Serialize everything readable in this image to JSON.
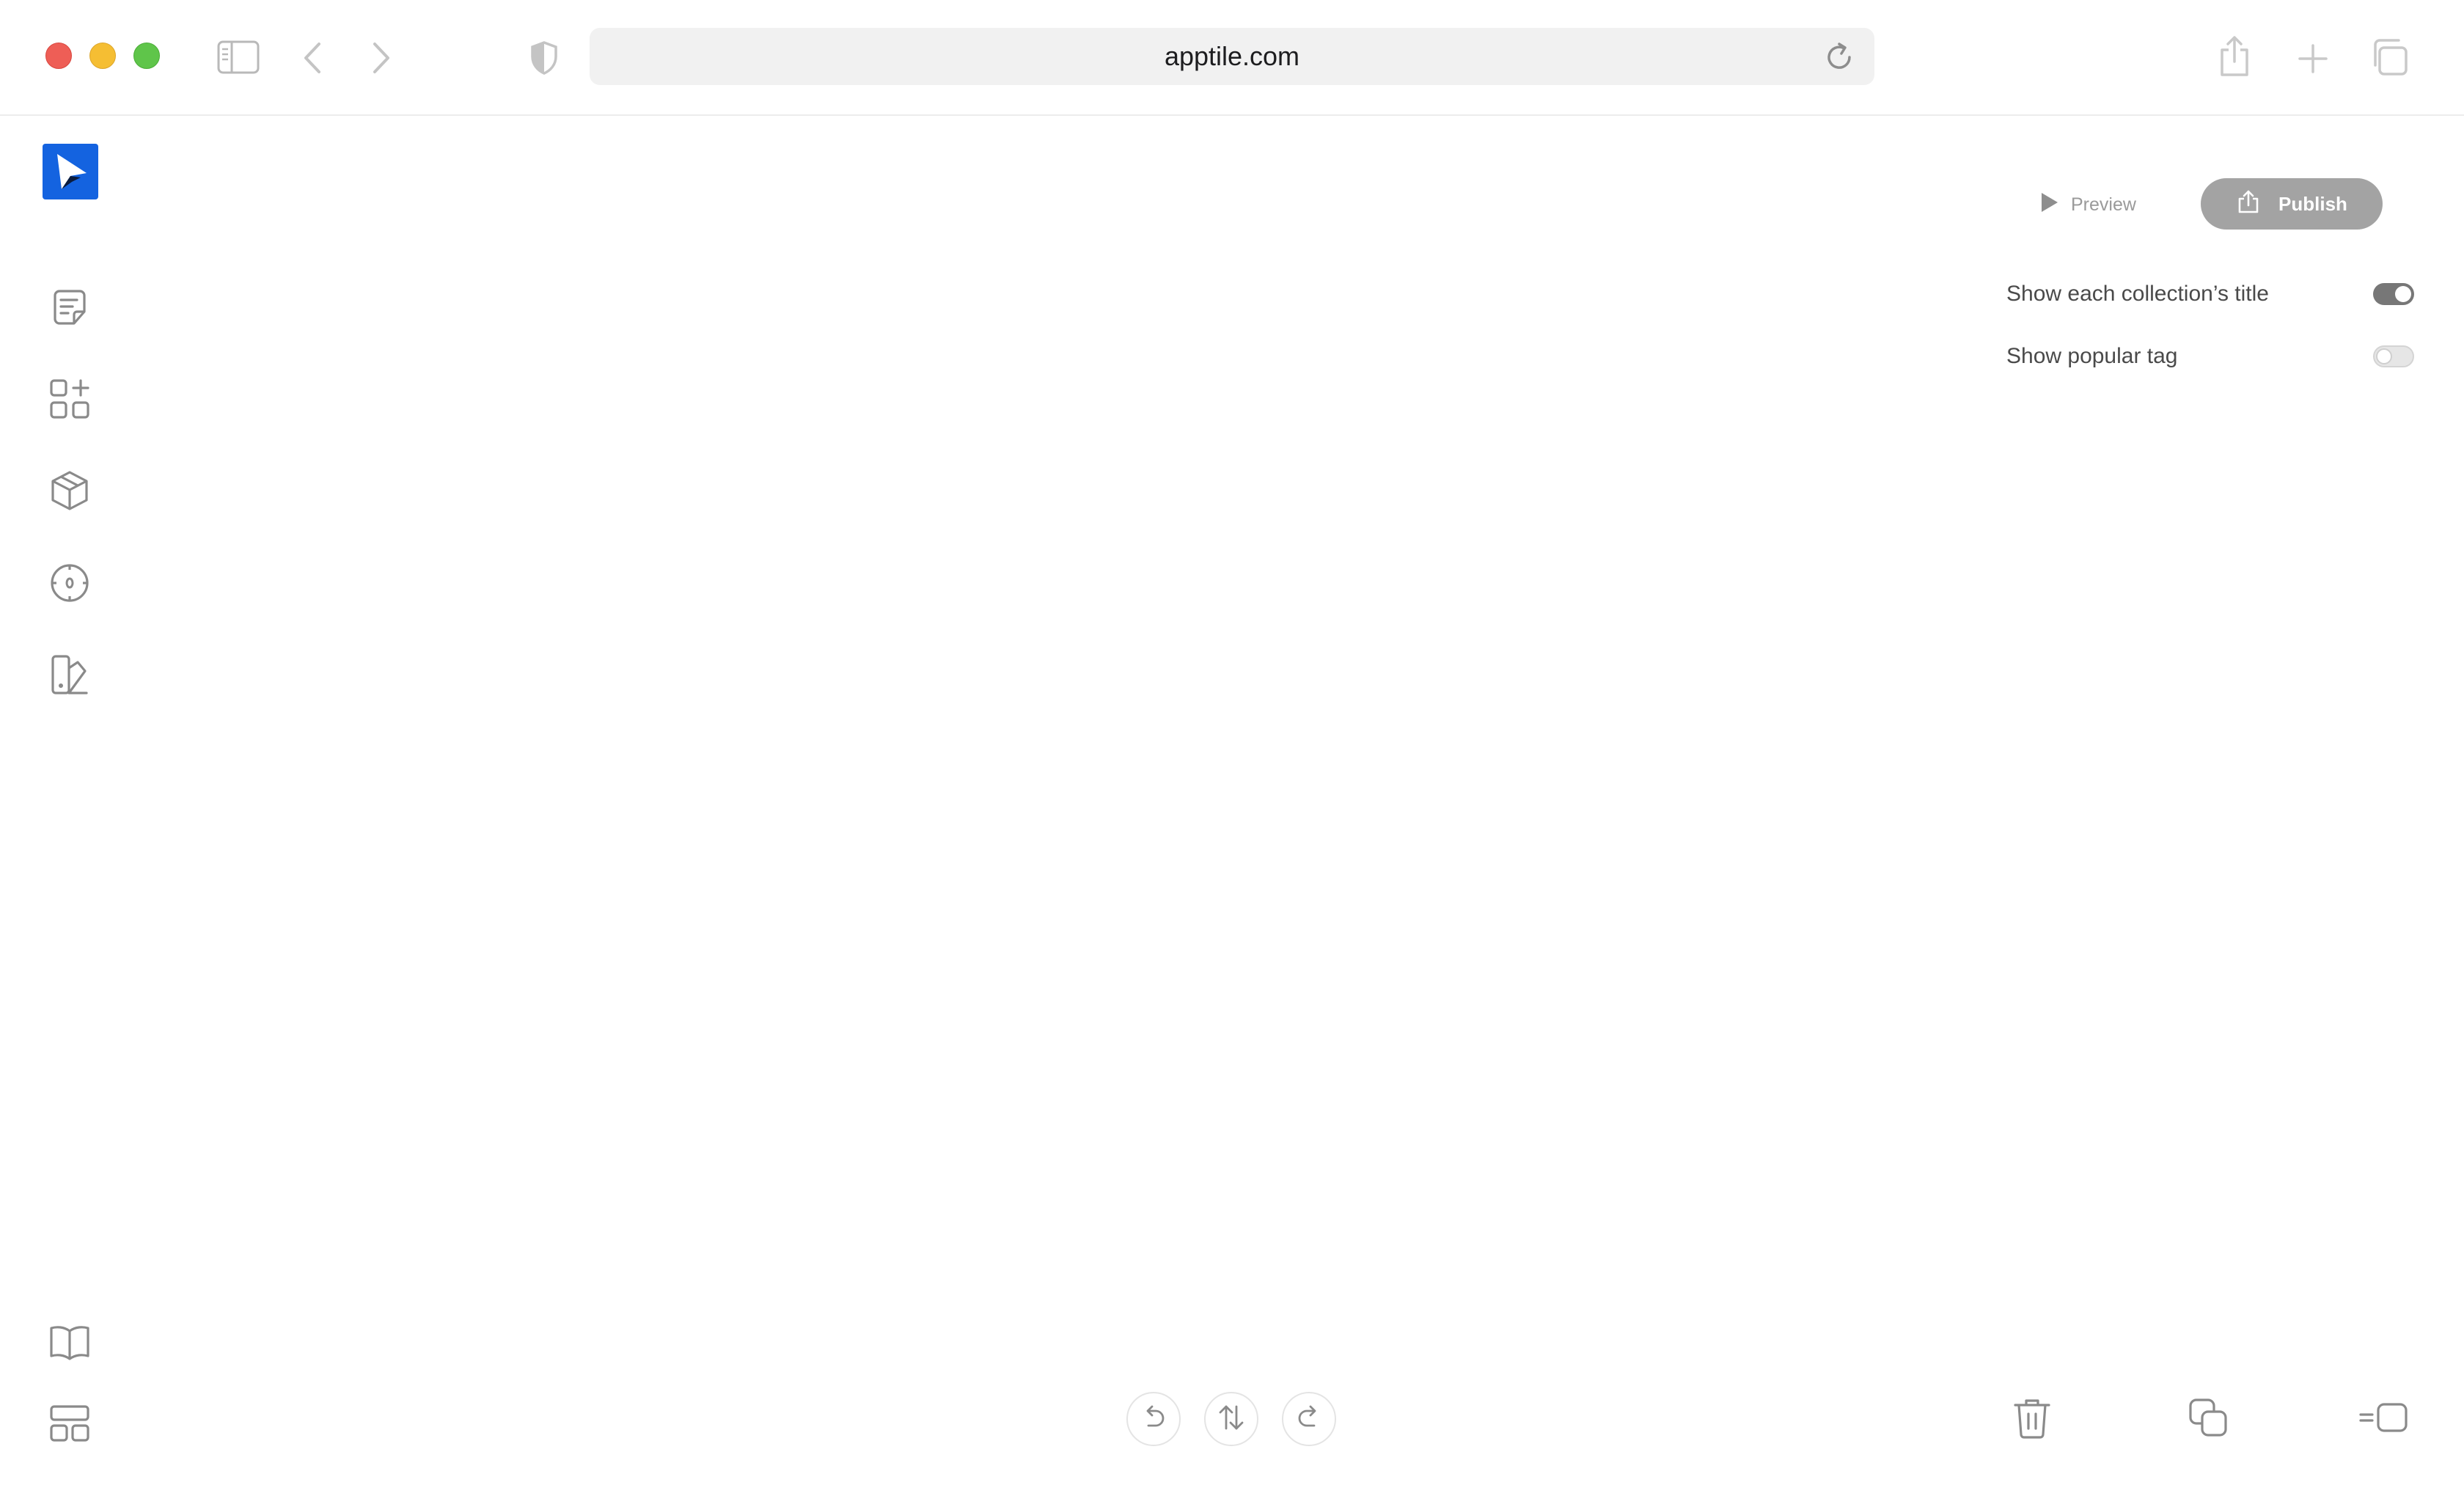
{
  "browser": {
    "url": "apptile.com"
  },
  "editor": {
    "preview_label": "Preview",
    "publish_label": "Publish",
    "brand_color": "#1463e0",
    "settings": [
      {
        "label": "Show each collection’s title",
        "enabled": true
      },
      {
        "label": "Show popular tag",
        "enabled": false
      }
    ]
  },
  "sidebar": {
    "icons": [
      "notes-icon",
      "add-widget-icon",
      "cube-icon",
      "compass-icon",
      "theme-swatch-icon"
    ],
    "bottom_icons": [
      "book-icon",
      "layout-icon"
    ]
  },
  "toolbar": {
    "center": [
      "undo-icon",
      "reorder-icon",
      "redo-icon"
    ],
    "right": [
      "trash-icon",
      "duplicate-icon",
      "align-icon"
    ]
  }
}
